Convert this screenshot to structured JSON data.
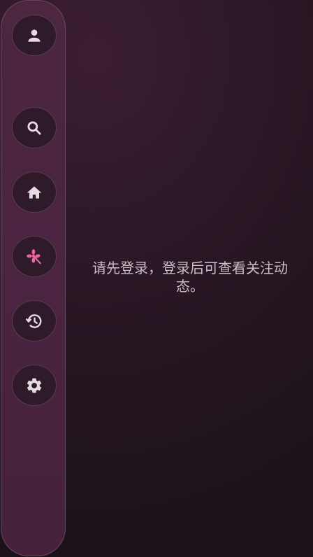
{
  "sidebar": {
    "items": [
      {
        "name": "profile",
        "icon": "person-icon"
      },
      {
        "name": "search",
        "icon": "search-icon"
      },
      {
        "name": "home",
        "icon": "home-icon"
      },
      {
        "name": "following",
        "icon": "pinwheel-icon",
        "active": true
      },
      {
        "name": "history",
        "icon": "history-icon"
      },
      {
        "name": "settings",
        "icon": "gear-icon"
      }
    ]
  },
  "main": {
    "message": "请先登录，登录后可查看关注动态。"
  },
  "colors": {
    "icon": "#e7dbe3",
    "active_icon": "#f0679a",
    "sidebar": "#4a2440",
    "button": "#2e1a28",
    "text": "#cbbdc6"
  }
}
